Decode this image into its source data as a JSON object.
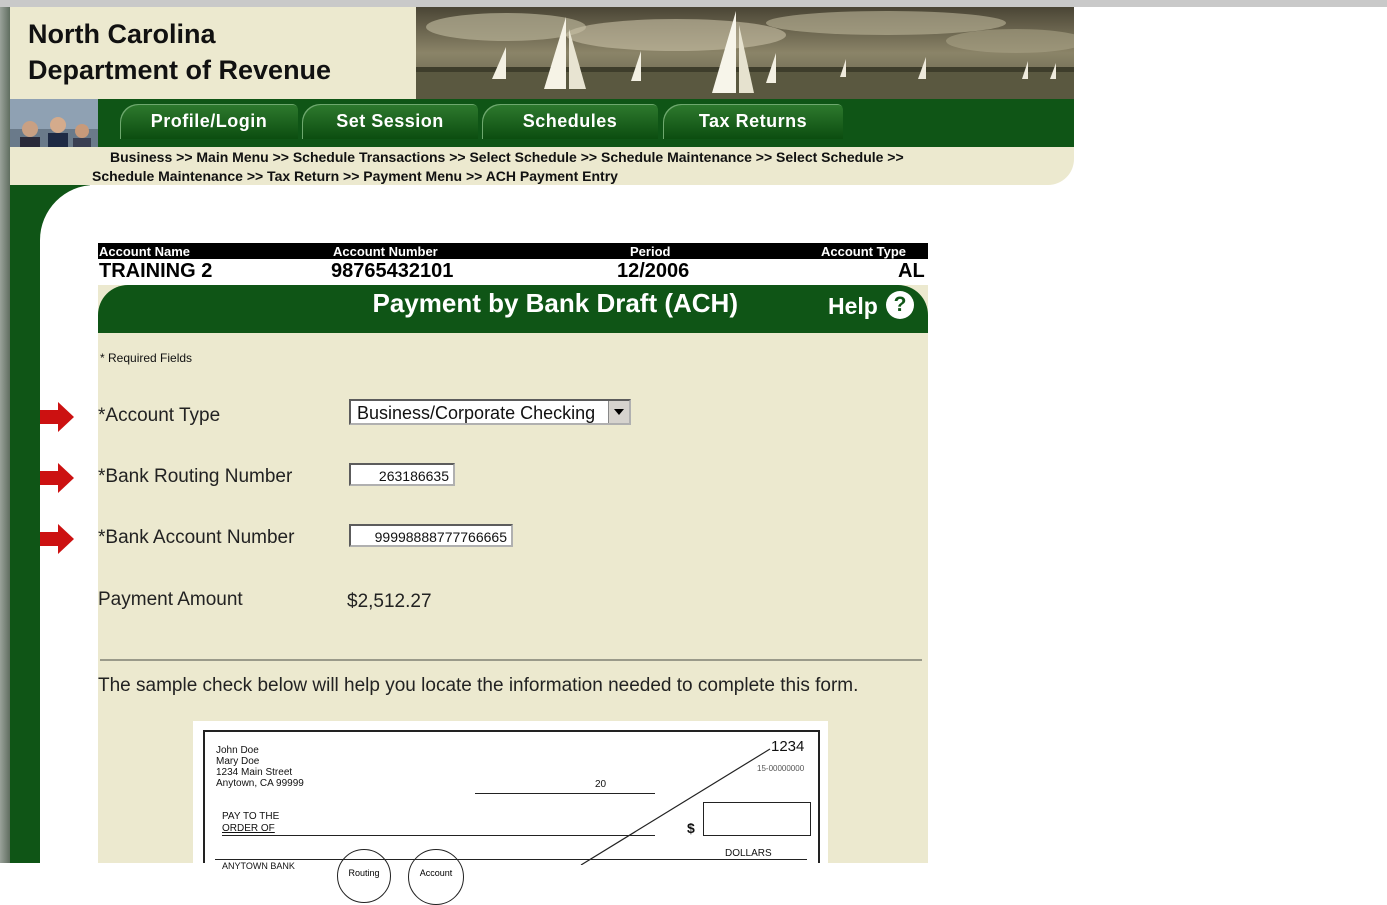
{
  "agency": {
    "line1": "North Carolina",
    "line2": "Department of Revenue"
  },
  "nav_tabs": [
    "Profile/Login",
    "Set Session",
    "Schedules",
    "Tax Returns"
  ],
  "breadcrumb": {
    "line1": "Business >> Main Menu >> Schedule Transactions >> Select Schedule >> Schedule Maintenance >> Select Schedule >>",
    "line2": "Schedule Maintenance >> Tax Return >> Payment Menu >> ACH Payment Entry"
  },
  "account": {
    "headers": [
      "Account Name",
      "Account Number",
      "Period",
      "Account Type"
    ],
    "values": [
      "TRAINING 2",
      "98765432101",
      "12/2006",
      "AL"
    ]
  },
  "form": {
    "title": "Payment by Bank Draft (ACH)",
    "help_label": "Help",
    "help_icon": "?",
    "required_note": "* Required Fields",
    "account_type_label": "*Account Type",
    "account_type_value": "Business/Corporate Checking",
    "routing_label": "*Bank Routing Number",
    "routing_value": "263186635",
    "account_number_label": "*Bank Account Number",
    "account_number_value": "99998888777766665",
    "payment_amount_label": "Payment Amount",
    "payment_amount_value": "$2,512.27",
    "sample_note": "The sample check below will help you locate the information needed to complete this form."
  },
  "check": {
    "name1": "John Doe",
    "name2": "Mary Doe",
    "street": "1234 Main Street",
    "city": "Anytown, CA 99999",
    "number": "1234",
    "fraction": "15-00000000",
    "date_year": "20",
    "pay_to_1": "PAY TO THE",
    "pay_to_2": "ORDER OF",
    "dollar_sign": "$",
    "dollars": "DOLLARS",
    "bank": "ANYTOWN BANK",
    "circle1": "Routing",
    "circle2": "Account"
  },
  "colors": {
    "brand_green": "#0f5516",
    "panel_beige": "#ece9cf",
    "arrow_red": "#cc1111"
  },
  "icons": [
    "chevron-down-icon",
    "help-icon",
    "red-arrow-icon"
  ]
}
